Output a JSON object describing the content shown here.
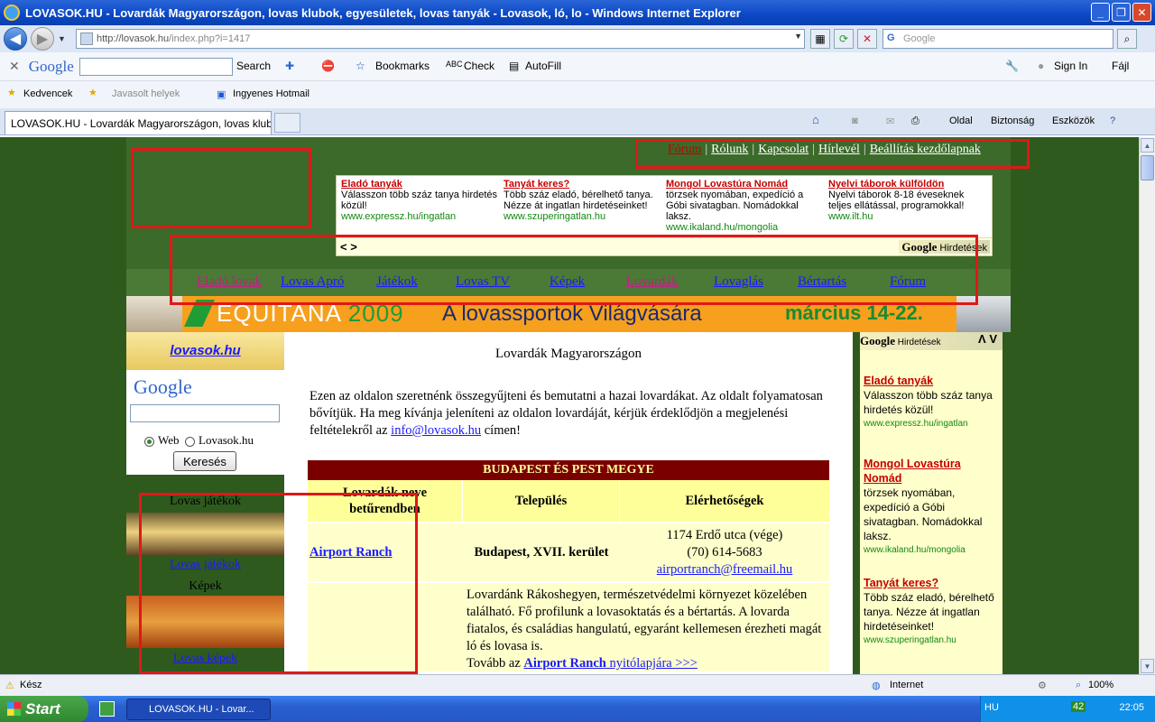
{
  "window": {
    "title": "LOVASOK.HU - Lovardák Magyarországon, lovas klubok, egyesületek, lovas tanyák - Lovasok, ló, lo - Windows Internet Explorer"
  },
  "address": {
    "url_host": "http://lovasok.hu",
    "url_path": "/index.php?i=1417",
    "search_placeholder": "Google"
  },
  "google_toolbar": {
    "logo": "Google",
    "search": "Search",
    "bookmarks": "Bookmarks",
    "check": "Check",
    "autofill": "AutoFill",
    "signin": "Sign In",
    "file": "Fájl"
  },
  "favorites": {
    "label": "Kedvencek",
    "suggested": "Javasolt helyek",
    "hotmail": "Ingyenes Hotmail"
  },
  "tab": {
    "label": "LOVASOK.HU - Lovardák Magyarországon, lovas klub..."
  },
  "commandbar": {
    "page": "Oldal",
    "security": "Biztonság",
    "tools": "Eszközök"
  },
  "site": {
    "toplinks": {
      "forum": "Fórum",
      "about": "Rólunk",
      "contact": "Kapcsolat",
      "newsletter": "Hírlevél",
      "homepage": "Beállítás kezdőlapnak"
    },
    "top_ads": [
      {
        "title": "Eladó tanyák",
        "text": "Válasszon több száz tanya hirdetés közül!",
        "url": "www.expressz.hu/ingatlan"
      },
      {
        "title": "Tanyát keres?",
        "text": "Több száz eladó, bérelhető tanya. Nézze át ingatlan hirdetéseinket!",
        "url": "www.szuperingatlan.hu"
      },
      {
        "title": "Mongol Lovastúra Nomád",
        "text": "törzsek nyomában, expedíció a Góbi sivatagban. Nomádokkal laksz.",
        "url": "www.ikaland.hu/mongolia"
      },
      {
        "title": "Nyelvi táborok külföldön",
        "text": "Nyelvi táborok 8-18 éveseknek teljes ellátással, programokkal!",
        "url": "www.ilt.hu"
      }
    ],
    "ads_arrows": "< >",
    "google_hirdetesek_logo": "Google",
    "google_hirdetesek_label": "Hirdetések",
    "nav": [
      {
        "label": "Eladó lovak"
      },
      {
        "label": "Lovas Apró"
      },
      {
        "label": "Játékok"
      },
      {
        "label": "Lovas TV"
      },
      {
        "label": "Képek"
      },
      {
        "label": "Lovardák"
      },
      {
        "label": "Lovaglás"
      },
      {
        "label": "Bértartás"
      },
      {
        "label": "Fórum"
      }
    ],
    "banner": {
      "brand": "EQUITANA",
      "year": "2009",
      "slogan": "A lovassportok Világvására",
      "date": "március 14-22."
    },
    "left": {
      "brand": "lovasok.hu",
      "google_logo": "Google",
      "radio_web": "Web",
      "radio_site": "Lovasok.hu",
      "search_button": "Keresés",
      "games_heading": "Lovas játékok",
      "games_link": "Lovas játékok",
      "pictures_heading": "Képek",
      "pictures_link": "Lovas képek"
    },
    "content": {
      "title": "Lovardák Magyarországon",
      "intro_1": "Ezen az oldalon szeretnénk összegyűjteni és bemutatni a hazai lovardákat. Az oldalt folyamatosan bővítjük. Ha meg kívánja jeleníteni az oldalon lovardáját, kérjük érdeklődjön a megjelenési feltételekről az ",
      "intro_email": "info@lovasok.hu",
      "intro_2": " címen!",
      "region": "BUDAPEST ÉS PEST MEGYE",
      "col_name": "Lovardák neve betűrendben",
      "col_town": "Település",
      "col_contact": "Elérhetőségek",
      "row": {
        "name": "Airport Ranch",
        "town": "Budapest, XVII. kerület",
        "address": "1174 Erdő utca (vége)",
        "phone": "(70) 614-5683",
        "email": "airportranch@freemail.hu",
        "desc": "Lovardánk Rákoshegyen, természetvédelmi környezet közelében található. Fő profilunk a lovasoktatás és a bértartás. A lovarda fiatalos, és családias hangulatú, egyaránt kellemesen érezheti magát ló és lovasa is.",
        "more_prefix": "Tovább az ",
        "more_link_bold": "Airport Ranch",
        "more_link": " nyitólapjára >>>"
      }
    },
    "right": {
      "header_logo": "Google",
      "header_label": "Hirdetések",
      "arrows": "Λ V",
      "ads": [
        {
          "title": "Eladó tanyák",
          "text": "Válasszon több száz tanya hirdetés közül!",
          "url": "www.expressz.hu/ingatlan"
        },
        {
          "title": "Mongol Lovastúra Nomád",
          "text": "törzsek nyomában, expedíció a Góbi sivatagban. Nomádokkal laksz.",
          "url": "www.ikaland.hu/mongolia"
        },
        {
          "title": "Tanyát keres?",
          "text": "Több száz eladó, bérelhető tanya. Nézze át ingatlan hirdetéseinket!",
          "url": "www.szuperingatlan.hu"
        }
      ]
    }
  },
  "status": {
    "ready": "Kész",
    "zone": "Internet",
    "zoom": "100%"
  },
  "taskbar": {
    "start": "Start",
    "task": "LOVASOK.HU - Lovar...",
    "lang": "HU",
    "time": "22:05",
    "tray_number": "42"
  },
  "colors": {
    "page_bg": "#2e5a1e",
    "ad_title": "#c40000",
    "link": "#1a1aff",
    "region_bg": "#7a0000",
    "annotation": "#e01818"
  }
}
